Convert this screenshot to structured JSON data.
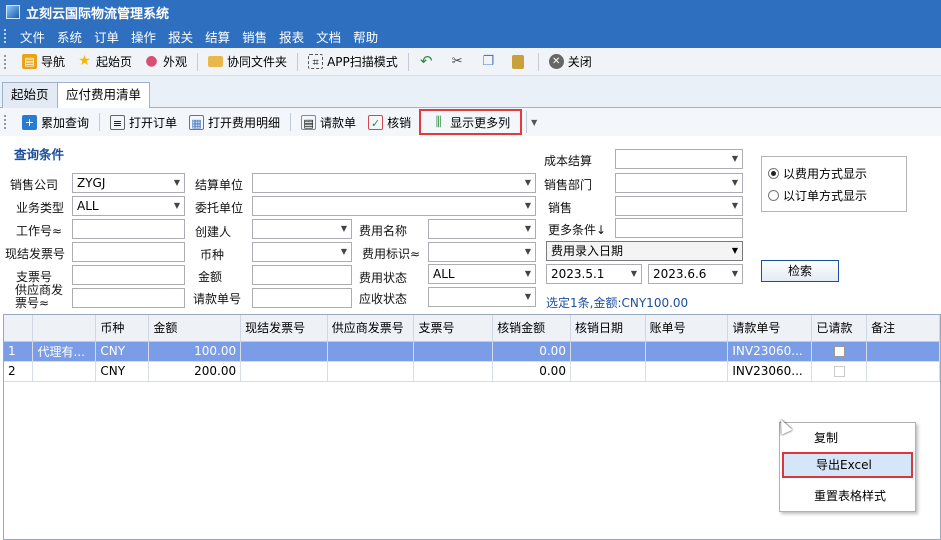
{
  "window": {
    "title": "立刻云国际物流管理系统"
  },
  "menu": [
    "文件",
    "系统",
    "订单",
    "操作",
    "报关",
    "结算",
    "销售",
    "报表",
    "文档",
    "帮助"
  ],
  "toolbar": [
    {
      "label": "导航",
      "icon": "navigation-icon",
      "color": "#e8a317"
    },
    {
      "label": "起始页",
      "icon": "star-icon",
      "color": "#f2b705"
    },
    {
      "label": "外观",
      "icon": "palette-icon",
      "color": "#d94f70"
    },
    {
      "label": "协同文件夹",
      "icon": "folder-icon",
      "color": "#e8b84a"
    },
    {
      "label": "APP扫描模式",
      "icon": "scan-icon",
      "color": "#555555"
    },
    {
      "label": "",
      "icon": "undo-icon",
      "color": "#2e8b3e"
    },
    {
      "label": "",
      "icon": "cut-icon",
      "color": "#444444"
    },
    {
      "label": "",
      "icon": "copy-icon",
      "color": "#4a78c2"
    },
    {
      "label": "",
      "icon": "paste-icon",
      "color": "#c9a13a"
    },
    {
      "label": "关闭",
      "icon": "close-circle-icon",
      "color": "#666666"
    }
  ],
  "tabs": [
    {
      "label": "起始页",
      "active": false
    },
    {
      "label": "应付费用清单",
      "active": true
    }
  ],
  "subtoolbar": [
    {
      "label": "累加查询",
      "icon": "add-search-icon",
      "color": "#2a7bd4"
    },
    {
      "label": "打开订单",
      "icon": "open-order-icon",
      "color": "#666666"
    },
    {
      "label": "打开费用明细",
      "icon": "detail-icon",
      "color": "#4a78c2"
    },
    {
      "label": "请款单",
      "icon": "request-icon",
      "color": "#888888"
    },
    {
      "label": "核销",
      "icon": "writeoff-icon",
      "color": "#d44a4a"
    },
    {
      "label": "显示更多列",
      "icon": "columns-icon",
      "color": "#2e8b3e"
    }
  ],
  "query": {
    "section_title": "查询条件",
    "labels": {
      "sales_company": "销售公司",
      "settle_unit": "结算单位",
      "cost_settle": "成本结算",
      "business_type": "业务类型",
      "client_unit": "委托单位",
      "sales_dept": "销售部门",
      "job_no": "工作号≈",
      "creator": "创建人",
      "fee_name": "费用名称",
      "sales": "销售",
      "invoice_no": "现结发票号",
      "currency": "币种",
      "fee_flag": "费用标识≈",
      "more_cond": "更多条件↓",
      "check_no": "支票号",
      "amount": "金额",
      "fee_status": "费用状态",
      "supplier_invoice": "供应商发票号≈",
      "request_no": "请款单号",
      "recv_status": "应收状态"
    },
    "values": {
      "sales_company": "ZYGJ",
      "business_type": "ALL",
      "fee_status": "ALL",
      "date_type": "费用录入日期",
      "date_from": "2023.5.1",
      "date_to": "2023.6.6"
    },
    "radio": {
      "by_fee": "以费用方式显示",
      "by_order": "以订单方式显示"
    },
    "search_button": "检索",
    "selection_status": "选定1条,金额:CNY100.00"
  },
  "grid": {
    "columns": [
      "",
      "",
      "币种",
      "金额",
      "现结发票号",
      "供应商发票号",
      "支票号",
      "核销金额",
      "核销日期",
      "账单号",
      "请款单号",
      "已请款",
      "备注"
    ],
    "rows": [
      {
        "no": "1",
        "name": "代理有...",
        "currency": "CNY",
        "amount": "100.00",
        "writeoff": "0.00",
        "request_no": "INV23060...",
        "selected": true
      },
      {
        "no": "2",
        "name": "",
        "currency": "CNY",
        "amount": "200.00",
        "writeoff": "0.00",
        "request_no": "INV23060...",
        "selected": false
      }
    ]
  },
  "context_menu": [
    "复制",
    "导出Excel",
    "重置表格样式"
  ],
  "colors": {
    "title_blue": "#2f6fc0",
    "selection": "#7b9ce6",
    "highlight_red": "#e03a3a"
  }
}
